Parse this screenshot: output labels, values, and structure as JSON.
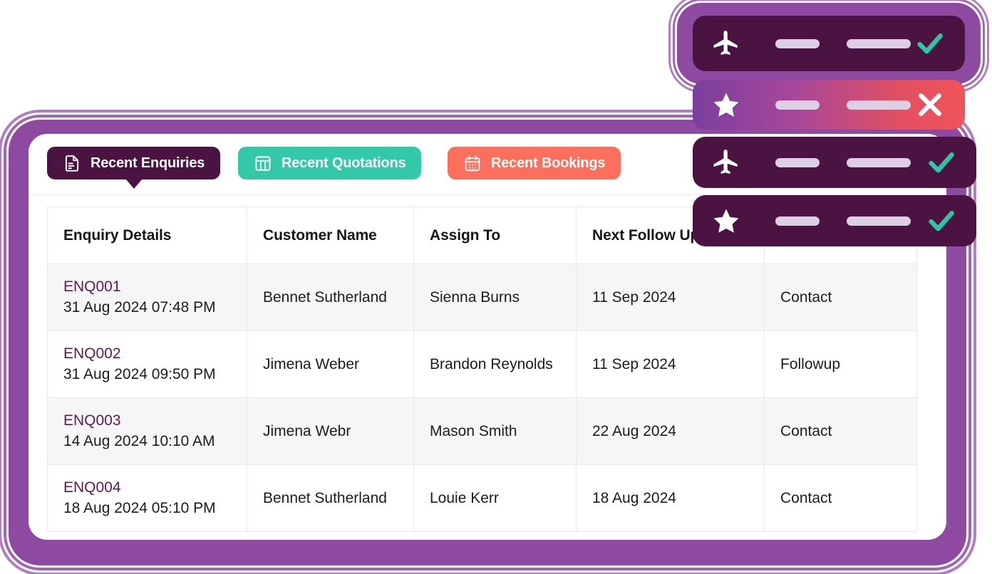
{
  "tabs": [
    {
      "id": "enquiries",
      "label": "Recent Enquiries",
      "icon": "document-icon",
      "color": "#4a1342",
      "active": true
    },
    {
      "id": "quotations",
      "label": "Recent Quotations",
      "icon": "table-icon",
      "color": "#33c8a8",
      "active": false
    },
    {
      "id": "bookings",
      "label": "Recent Bookings",
      "icon": "calendar-icon",
      "color": "#fb6f5c",
      "active": false
    }
  ],
  "table": {
    "headers": [
      "Enquiry Details",
      "Customer Name",
      "Assign To",
      "Next Follow Up",
      ""
    ],
    "rows": [
      {
        "enquiry_id": "ENQ001",
        "enquiry_date": "31 Aug 2024 07:48 PM",
        "customer_name": "Bennet Sutherland",
        "assign_to": "Sienna Burns",
        "next_follow_up": "11 Sep 2024",
        "status": "Contact"
      },
      {
        "enquiry_id": "ENQ002",
        "enquiry_date": "31 Aug 2024 09:50 PM",
        "customer_name": "Jimena Weber",
        "assign_to": "Brandon Reynolds",
        "next_follow_up": "11 Sep 2024",
        "status": "Followup"
      },
      {
        "enquiry_id": "ENQ003",
        "enquiry_date": "14 Aug 2024 10:10 AM",
        "customer_name": "Jimena Webr",
        "assign_to": "Mason Smith",
        "next_follow_up": "22 Aug 2024",
        "status": "Contact"
      },
      {
        "enquiry_id": "ENQ004",
        "enquiry_date": "18 Aug 2024 05:10 PM",
        "customer_name": "Bennet Sutherland",
        "assign_to": "Louie Kerr",
        "next_follow_up": "18 Aug 2024",
        "status": "Contact"
      }
    ]
  },
  "float_cards": [
    {
      "id": "card-1",
      "icon": "plane-icon",
      "status_icon": "check-icon",
      "status_color": "#2ec4a6",
      "background": "#4a1342"
    },
    {
      "id": "card-2",
      "icon": "star-icon",
      "status_icon": "close-icon",
      "status_color": "#ffffff",
      "background": "gradient-purple-red"
    },
    {
      "id": "card-3",
      "icon": "plane-icon",
      "status_icon": "check-icon",
      "status_color": "#2ec4a6",
      "background": "#4a1342"
    },
    {
      "id": "card-4",
      "icon": "star-icon",
      "status_icon": "check-icon",
      "status_color": "#2ec4a6",
      "background": "#4a1342"
    }
  ],
  "colors": {
    "frame_purple": "#8e4aa0",
    "dark_purple": "#4a1342",
    "teal": "#33c8a8",
    "coral": "#fb6f5c",
    "link_purple": "#5d1a52",
    "row_stripe": "#f6f6f7"
  }
}
